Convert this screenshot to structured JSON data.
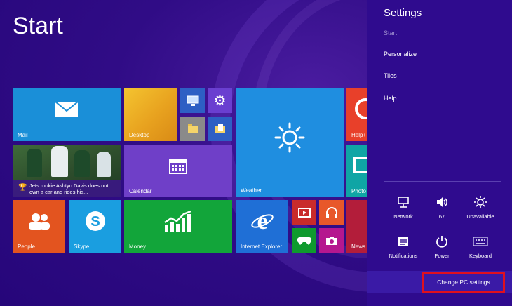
{
  "start": {
    "title": "Start",
    "tiles": {
      "mail": "Mail",
      "desktop": "Desktop",
      "weather": "Weather",
      "help": "Help+",
      "calendar": "Calendar",
      "photos": "Photo",
      "people": "People",
      "skype": "Skype",
      "money": "Money",
      "ie": "Internet Explorer",
      "news": "News",
      "news_story": "Jets rookie Ashtyn Davis does not own a car and rides his..."
    }
  },
  "settings": {
    "title": "Settings",
    "start": "Start",
    "personalize": "Personalize",
    "tiles": "Tiles",
    "help": "Help",
    "quick": {
      "network": "Network",
      "volume": "67",
      "brightness": "Unavailable",
      "notifications": "Notifications",
      "power": "Power",
      "keyboard": "Keyboard"
    },
    "change_pc": "Change PC settings"
  },
  "colors": {
    "highlight": "#e0101e",
    "panel": "#2f0b8e"
  }
}
